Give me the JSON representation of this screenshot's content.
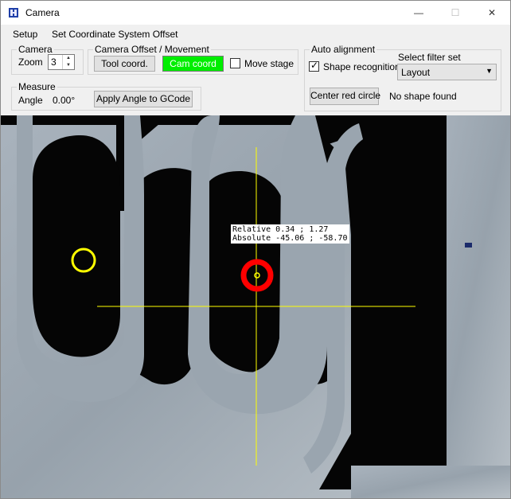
{
  "window": {
    "title": "Camera",
    "icon": "camera-app-icon",
    "controls": {
      "minimize": "—",
      "maximize": "☐",
      "close": "✕"
    }
  },
  "menu": [
    "Setup",
    "Set Coordinate System Offset"
  ],
  "camera_group": {
    "legend": "Camera",
    "zoom_label": "Zoom",
    "zoom_value": "3"
  },
  "offset_group": {
    "legend": "Camera Offset / Movement",
    "tool_coord_label": "Tool coord.",
    "cam_coord_label": "Cam coord",
    "move_stage_label": "Move stage",
    "move_stage_checked": false
  },
  "measure_group": {
    "legend": "Measure",
    "angle_label": "Angle",
    "angle_value": "0.00°",
    "apply_angle_label": "Apply Angle to GCode"
  },
  "auto_align_group": {
    "legend": "Auto alignment",
    "shape_recognition_label": "Shape recognition",
    "shape_recognition_checked": true,
    "filter_label": "Select filter set",
    "filter_value": "Layout",
    "center_button_label": "Center red circle",
    "status_text": "No shape found"
  },
  "camera_view": {
    "overlay_line1": "Relative 0.34 ; 1.27",
    "overlay_line2": "Absolute -45.06 ; -58.70",
    "crosshair_color": "#ffff00",
    "detected_circle_color": "#ffff00",
    "target_circle_color": "#ff0000",
    "cam_coord_active_color": "#00ee00"
  }
}
